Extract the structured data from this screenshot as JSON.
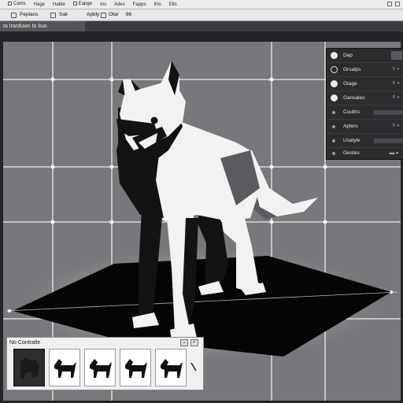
{
  "menu": {
    "items": [
      "Cams",
      "Hage",
      "Hable",
      "Eapge",
      "Ins",
      "Ades",
      "Fapps",
      "Ilns",
      "Elts"
    ]
  },
  "toolbar": {
    "items": [
      "Peplans",
      "Sak",
      "Apbly",
      "Otar",
      "86"
    ]
  },
  "tab": {
    "label": "ta Irarduws to Iiuo"
  },
  "properties": {
    "rows": [
      "Dep",
      "Grsalps",
      "Gtage",
      "Gansales",
      "Cuuttrs",
      "Apters",
      "Usatyle",
      "Gestes"
    ]
  },
  "presets": {
    "title": "No Contratle",
    "btn_down": "⌄",
    "btn_check": "✓"
  },
  "colors": {
    "canvas_bg": "#232426",
    "plane": "#77787b",
    "grid_line": "#ebebeb",
    "dog_white": "#f2f2f2",
    "dog_black": "#131313",
    "shadow": "#050505"
  },
  "icons": [
    "minimize-icon",
    "maximize-icon",
    "close-icon",
    "dog-silhouette-icon",
    "ellipse-icon",
    "slider-icon"
  ]
}
